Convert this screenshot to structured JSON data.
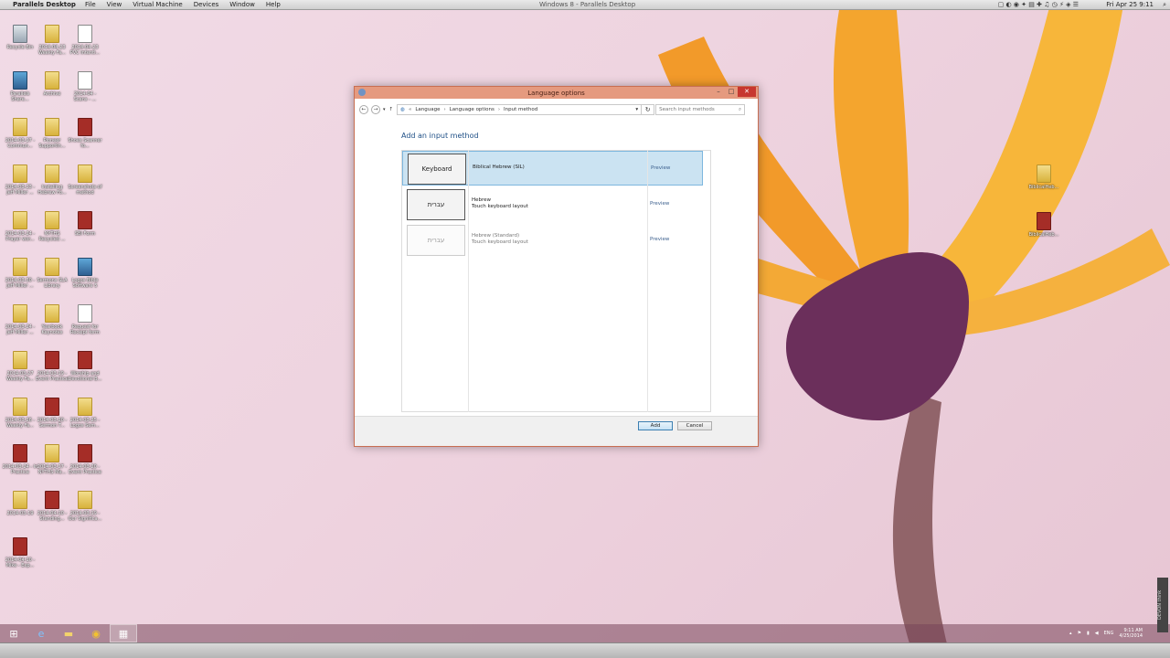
{
  "mac_menubar": {
    "app_name": "Parallels Desktop",
    "menus": [
      "File",
      "View",
      "Virtual Machine",
      "Devices",
      "Window",
      "Help"
    ],
    "window_title": "Windows 8 - Parallels Desktop",
    "clock": "Fri Apr 25  9:11"
  },
  "desktop_icons": [
    {
      "label": "Recycle Bin",
      "type": "bin"
    },
    {
      "label": "2014-04-23 Weekly Fa...",
      "type": "folder"
    },
    {
      "label": "2014-04-23 PVC Intenti...",
      "type": "doc"
    },
    {
      "label": "Parallels Share...",
      "type": "app"
    },
    {
      "label": "Archive",
      "type": "folder"
    },
    {
      "label": "2014-04 - Scans - ...",
      "type": "doc"
    },
    {
      "label": "2014-03-27 - Commun...",
      "type": "folder"
    },
    {
      "label": "Pioneer Supportin...",
      "type": "folder"
    },
    {
      "label": "Shoes Scanner fo...",
      "type": "pdf"
    },
    {
      "label": "2014-03-23 - Jeff Miller ...",
      "type": "folder"
    },
    {
      "label": "Installing Hebrew Fo...",
      "type": "folder"
    },
    {
      "label": "Screenshots of method",
      "type": "folder"
    },
    {
      "label": "2014-03-24 - Prayer wor...",
      "type": "folder"
    },
    {
      "label": "NYTHS Recycled ...",
      "type": "folder"
    },
    {
      "label": "SBI Form",
      "type": "pdf"
    },
    {
      "label": "2014-03-30 - Jeff Miller ...",
      "type": "folder"
    },
    {
      "label": "Sermons SLA Library",
      "type": "folder"
    },
    {
      "label": "Logos Bible Software 5",
      "type": "app"
    },
    {
      "label": "2014-03-24 - Jeff Miller ...",
      "type": "folder"
    },
    {
      "label": "Yearbook Keynotes",
      "type": "folder"
    },
    {
      "label": "Request for Receipt form",
      "type": "doc"
    },
    {
      "label": "2014-03-27 Weekly Fa...",
      "type": "folder"
    },
    {
      "label": "2014-03-19 - Event Practice",
      "type": "pdf"
    },
    {
      "label": "Worship and Devotional B...",
      "type": "pdf"
    },
    {
      "label": "2014-03-26 - Weekly Fa...",
      "type": "folder"
    },
    {
      "label": "2014-03-20 - Sermon T...",
      "type": "pdf"
    },
    {
      "label": "2014-03-25 - Logos Sem...",
      "type": "folder"
    },
    {
      "label": "2014-03-24 - In Practice",
      "type": "pdf"
    },
    {
      "label": "2014-03-27 - NYTHS Me...",
      "type": "folder"
    },
    {
      "label": "2014-03-20 - Event Practice",
      "type": "pdf"
    },
    {
      "label": "2014-03-19",
      "type": "folder"
    },
    {
      "label": "2014-04-10 - Standing...",
      "type": "pdf"
    },
    {
      "label": "2014-03-19 - Our Significa...",
      "type": "folder"
    },
    {
      "label": "2014-04-10 - Mike - Exp...",
      "type": "pdf"
    },
    {
      "label": "BiblicalHeb...",
      "type": "folder"
    },
    {
      "label": "BiblicalHeb...",
      "type": "pdf"
    }
  ],
  "window": {
    "title": "Language options",
    "breadcrumb": [
      "Language",
      "Language options",
      "Input method"
    ],
    "search_placeholder": "Search input methods",
    "heading": "Add an input method",
    "rows": [
      {
        "tile": "Keyboard",
        "name": "Biblical Hebrew (SIL)",
        "sub": "",
        "preview": "Preview",
        "selected": true
      },
      {
        "tile": "עברית",
        "name": "Hebrew",
        "sub": "Touch keyboard layout",
        "preview": "Preview",
        "selected": false
      },
      {
        "tile": "עברית",
        "name": "Hebrew (Standard)",
        "sub": "Touch keyboard layout",
        "preview": "Preview",
        "selected": false
      }
    ],
    "add_label": "Add",
    "cancel_label": "Cancel"
  },
  "taskbar": {
    "time": "9:11 AM",
    "date": "4/25/2014",
    "lang": "ENG"
  },
  "side_widget": "DEVON think"
}
